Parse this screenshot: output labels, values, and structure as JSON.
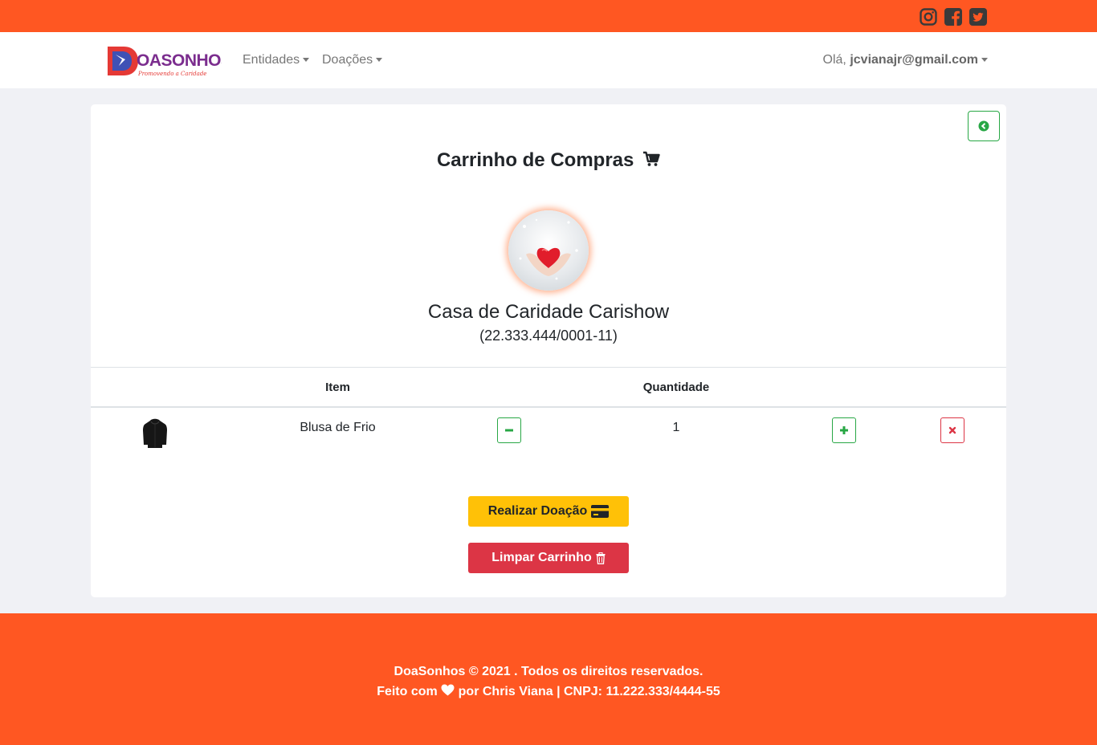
{
  "social": {
    "icons": [
      "instagram-icon",
      "facebook-icon",
      "twitter-icon"
    ]
  },
  "nav": {
    "logo_text": "DOASONHOS",
    "logo_tagline": "Promovendo a Caridade",
    "items": [
      {
        "label": "Entidades"
      },
      {
        "label": "Doações"
      }
    ],
    "greeting": "Olá,",
    "user_email": "jcvianajr@gmail.com"
  },
  "cart": {
    "title": "Carrinho de Compras",
    "entity_name": "Casa de Caridade Carishow",
    "entity_doc": "(22.333.444/0001-11)",
    "columns": {
      "item": "Item",
      "quantity": "Quantidade"
    },
    "rows": [
      {
        "name": "Blusa de Frio",
        "quantity": "1"
      }
    ],
    "donate_label": "Realizar Doação",
    "clear_label": "Limpar Carrinho"
  },
  "footer": {
    "line1": "DoaSonhos © 2021 . Todos os direitos reservados.",
    "line2_prefix": "Feito com",
    "line2_suffix": "por Chris Viana | CNPJ: 11.222.333/4444-55"
  },
  "colors": {
    "brand_orange": "#ff5722",
    "success": "#28a745",
    "danger": "#dc3545",
    "warning": "#ffc107"
  }
}
